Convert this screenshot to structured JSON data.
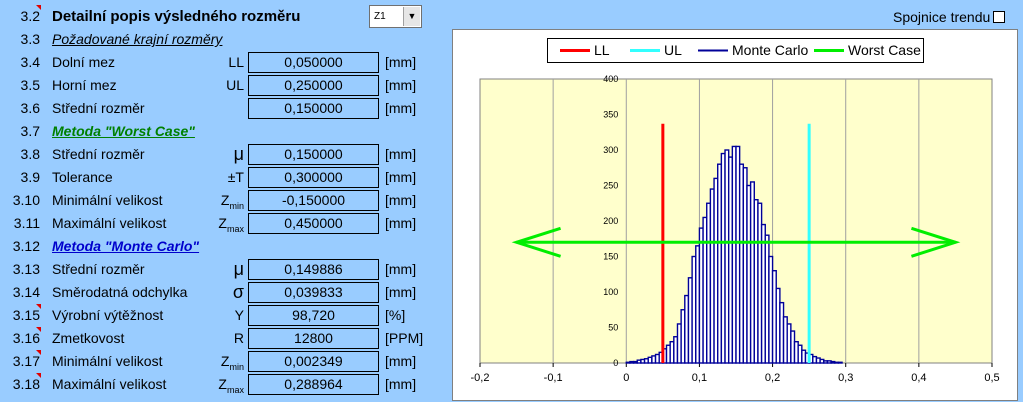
{
  "header": {
    "num": "3.2",
    "title": "Detailní popis výsledného rozměru",
    "dropdown_value": "Z1",
    "dropdown_arrow": "▼"
  },
  "trend": {
    "label": "Spojnice trendu"
  },
  "rows": [
    {
      "num": "3.3",
      "label": "Požadované krajní rozměry"
    },
    {
      "num": "3.4",
      "label": "Dolní mez",
      "symbol": "LL",
      "value": "0,050000",
      "unit": "[mm]"
    },
    {
      "num": "3.5",
      "label": "Horní mez",
      "symbol": "UL",
      "value": "0,250000",
      "unit": "[mm]"
    },
    {
      "num": "3.6",
      "label": "Střední rozměr",
      "value": "0,150000",
      "unit": "[mm]"
    },
    {
      "num": "3.7",
      "label": "Metoda \"Worst Case\"",
      "color": "#008000"
    },
    {
      "num": "3.8",
      "label": "Střední rozměr",
      "symbol": "μ",
      "value": "0,150000",
      "unit": "[mm]"
    },
    {
      "num": "3.9",
      "label": "Tolerance",
      "symbol": "±T",
      "value": "0,300000",
      "unit": "[mm]"
    },
    {
      "num": "3.10",
      "label": "Minimální velikost",
      "symbol": "Z",
      "symbol_sub": "min",
      "value": "-0,150000",
      "unit": "[mm]"
    },
    {
      "num": "3.11",
      "label": "Maximální velikost",
      "symbol": "Z",
      "symbol_sub": "max",
      "value": "0,450000",
      "unit": "[mm]"
    },
    {
      "num": "3.12",
      "label": "Metoda \"Monte Carlo\"",
      "color": "#0000cc"
    },
    {
      "num": "3.13",
      "label": "Střední rozměr",
      "symbol": "μ",
      "value": "0,149886",
      "unit": "[mm]"
    },
    {
      "num": "3.14",
      "label": "Směrodatná odchylka",
      "symbol": "σ",
      "value": "0,039833",
      "unit": "[mm]"
    },
    {
      "num": "3.15",
      "label": "Výrobní výtěžnost",
      "symbol": "Y",
      "value": "98,720",
      "unit": "[%]"
    },
    {
      "num": "3.16",
      "label": "Zmetkovost",
      "symbol": "R",
      "value": "12800",
      "unit": "[PPM]"
    },
    {
      "num": "3.17",
      "label": "Minimální velikost",
      "symbol": "Z",
      "symbol_sub": "min",
      "value": "0,002349",
      "unit": "[mm]"
    },
    {
      "num": "3.18",
      "label": "Maximální velikost",
      "symbol": "Z",
      "symbol_sub": "max",
      "value": "0,288964",
      "unit": "[mm]"
    }
  ],
  "colors": {
    "background": "#99ccff",
    "plot_area": "#ffffcc",
    "ll": "#ff0000",
    "ul": "#33ffff",
    "monte_carlo": "#000099",
    "worst_case": "#00ee00"
  },
  "chart_data": {
    "type": "bar",
    "legend": [
      "LL",
      "UL",
      "Monte Carlo",
      "Worst Case"
    ],
    "xlim": [
      -0.2,
      0.5
    ],
    "ylim": [
      0,
      400
    ],
    "x_ticks": [
      "-0,2",
      "-0,1",
      "0",
      "0,1",
      "0,2",
      "0,3",
      "0,4",
      "0,5"
    ],
    "y_ticks": [
      "0",
      "50",
      "100",
      "150",
      "200",
      "250",
      "300",
      "350",
      "400"
    ],
    "ll": 0.05,
    "ul": 0.25,
    "worst_case": {
      "x": [
        -0.15,
        0.45
      ],
      "y": 170
    },
    "monte_carlo": {
      "bin_width": 0.005,
      "x": [
        0.0,
        0.005,
        0.01,
        0.015,
        0.02,
        0.025,
        0.03,
        0.035,
        0.04,
        0.045,
        0.05,
        0.055,
        0.06,
        0.065,
        0.07,
        0.075,
        0.08,
        0.085,
        0.09,
        0.095,
        0.1,
        0.105,
        0.11,
        0.115,
        0.12,
        0.125,
        0.13,
        0.135,
        0.14,
        0.145,
        0.15,
        0.155,
        0.16,
        0.165,
        0.17,
        0.175,
        0.18,
        0.185,
        0.19,
        0.195,
        0.2,
        0.205,
        0.21,
        0.215,
        0.22,
        0.225,
        0.23,
        0.235,
        0.24,
        0.245,
        0.25,
        0.255,
        0.26,
        0.265,
        0.27,
        0.275,
        0.28,
        0.285,
        0.29
      ],
      "values": [
        1,
        2,
        2,
        4,
        5,
        6,
        8,
        10,
        12,
        15,
        20,
        25,
        30,
        37,
        55,
        75,
        95,
        120,
        150,
        165,
        190,
        205,
        225,
        245,
        260,
        280,
        295,
        300,
        290,
        305,
        305,
        280,
        275,
        250,
        255,
        230,
        225,
        195,
        180,
        150,
        130,
        105,
        85,
        65,
        55,
        45,
        30,
        25,
        18,
        14,
        12,
        9,
        7,
        5,
        3,
        3,
        2,
        1,
        1
      ]
    }
  }
}
